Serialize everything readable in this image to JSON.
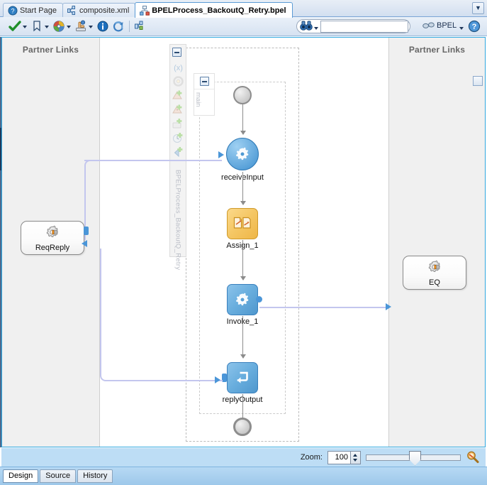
{
  "window": {
    "editor_tabs": [
      {
        "label": "Start Page",
        "icon": "help-question-icon",
        "active": false
      },
      {
        "label": "composite.xml",
        "icon": "composite-diagram-icon",
        "active": false
      },
      {
        "label": "BPELProcess_BackoutQ_Retry.bpel",
        "icon": "bpel-process-icon",
        "active": true
      }
    ],
    "tab_overflow_label": "▼"
  },
  "toolbar": {
    "buttons": [
      {
        "name": "validate-button",
        "icon": "green-check-icon",
        "has_dropdown": true
      },
      {
        "name": "bookmark-button",
        "icon": "bookmark-icon",
        "has_dropdown": true
      },
      {
        "name": "palette-button",
        "icon": "color-palette-icon",
        "has_dropdown": true
      },
      {
        "name": "deploy-button",
        "icon": "deploy-hand-icon",
        "has_dropdown": true
      },
      {
        "name": "info-button",
        "icon": "info-circle-icon",
        "has_dropdown": false
      },
      {
        "name": "refresh-button",
        "icon": "refresh-arrows-icon",
        "has_dropdown": false
      },
      {
        "name": "structure-button",
        "icon": "structure-tree-icon",
        "has_dropdown": false
      }
    ],
    "search": {
      "value": "",
      "placeholder": "",
      "icon": "binoculars-icon"
    },
    "mode_label": "BPEL",
    "mode_icon": "glasses-icon",
    "help_icon": "help-question-icon"
  },
  "editor": {
    "left_panel_title": "Partner Links",
    "right_panel_title": "Partner Links",
    "process_name": "BPELProcess_BackoutQ_Retry",
    "scope_label": "main",
    "palette_icons": [
      "collapse-box-icon",
      "variables-x-icon",
      "gear-icon",
      "fault-handler-add-icon",
      "catch-all-add-icon",
      "event-add-icon",
      "timer-add-icon",
      "compensate-add-icon"
    ],
    "partner_links": [
      {
        "name": "ReqReply",
        "label": "ReqReply",
        "side": "left",
        "icon": "partner-link-gear-icon"
      },
      {
        "name": "EQ",
        "label": "EQ",
        "side": "right",
        "icon": "partner-link-gear-icon"
      }
    ],
    "flow_nodes": [
      {
        "name": "start-node",
        "label": "",
        "type": "start-event"
      },
      {
        "name": "receive-input-node",
        "label": "receiveInput",
        "type": "receive"
      },
      {
        "name": "assign-1-node",
        "label": "Assign_1",
        "type": "assign"
      },
      {
        "name": "invoke-1-node",
        "label": "Invoke_1",
        "type": "invoke"
      },
      {
        "name": "reply-output-node",
        "label": "replyOutput",
        "type": "reply"
      },
      {
        "name": "end-node",
        "label": "",
        "type": "end-event"
      }
    ]
  },
  "zoombar": {
    "label": "Zoom:",
    "value": "100",
    "slider_position_percent": 45,
    "magnifier_icon": "magnifier-icon"
  },
  "bottom_tabs": [
    {
      "label": "Design",
      "active": true
    },
    {
      "label": "Source",
      "active": false
    },
    {
      "label": "History",
      "active": false
    }
  ],
  "colors": {
    "accent_blue": "#2fa8e0",
    "link_lavender": "#c3c6ee",
    "arrow_blue": "#4b96d8",
    "assign_yellow": "#f5c765",
    "activity_blue": "#69aede",
    "panel_gray": "#f0f0f0"
  }
}
